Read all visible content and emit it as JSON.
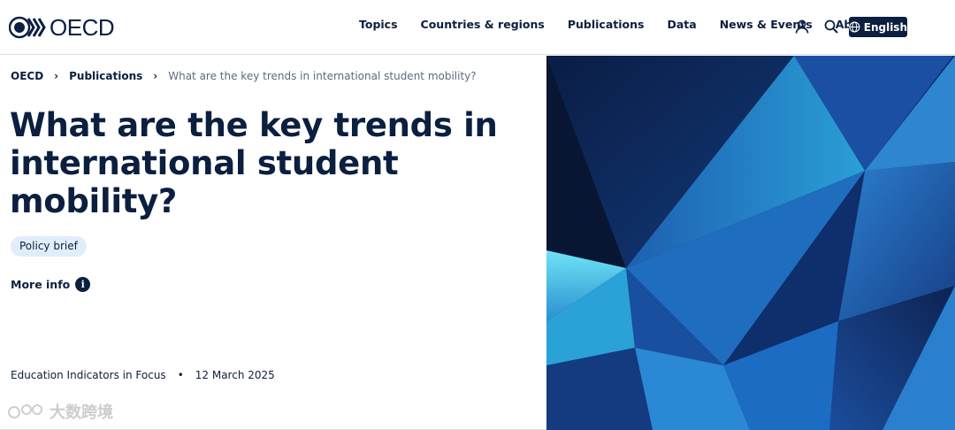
{
  "brand": {
    "name": "OECD"
  },
  "nav": {
    "items": [
      "Topics",
      "Countries & regions",
      "Publications",
      "Data",
      "News & Events",
      "About"
    ],
    "language_label": "English"
  },
  "breadcrumb": {
    "items": [
      "OECD",
      "Publications"
    ],
    "current": "What are the key trends in international student mobility?"
  },
  "article": {
    "title": "What are the key trends in international student mobility?",
    "type_badge": "Policy brief",
    "more_info_label": "More info",
    "series": "Education Indicators in Focus",
    "date": "12 March 2025"
  },
  "watermark": {
    "text": "大数跨境"
  },
  "colors": {
    "navy": "#0b1f3f",
    "badge_bg": "#e1eefa",
    "breadcrumb_current": "#5d6a7f"
  }
}
